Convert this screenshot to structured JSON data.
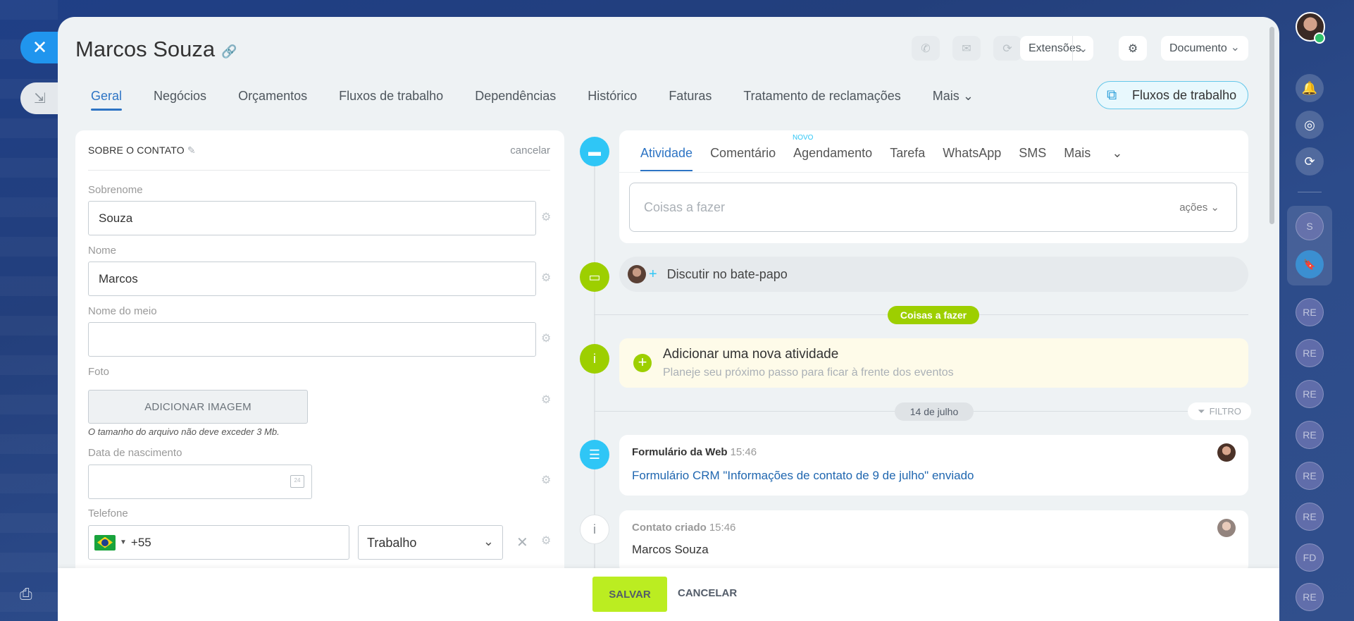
{
  "contact_name": "Marcos Souza",
  "header_buttons": {
    "extensions": "Extensões",
    "document": "Documento"
  },
  "tabs": [
    {
      "label": "Geral"
    },
    {
      "label": "Negócios"
    },
    {
      "label": "Orçamentos"
    },
    {
      "label": "Fluxos de trabalho"
    },
    {
      "label": "Dependências"
    },
    {
      "label": "Histórico"
    },
    {
      "label": "Faturas"
    },
    {
      "label": "Tratamento de reclamações"
    },
    {
      "label": "Mais"
    }
  ],
  "workflows_button": "Fluxos de trabalho",
  "contact_card": {
    "heading": "SOBRE O CONTATO",
    "cancel": "cancelar",
    "surname_label": "Sobrenome",
    "surname_value": "Souza",
    "name_label": "Nome",
    "name_value": "Marcos",
    "middle_label": "Nome do meio",
    "middle_value": "",
    "photo_label": "Foto",
    "add_image": "ADICIONAR IMAGEM",
    "photo_hint": "O tamanho do arquivo não deve exceder 3 Mb.",
    "birth_label": "Data de nascimento",
    "birth_value": "",
    "calendar_day": "24",
    "phone_label": "Telefone",
    "phone_code": "+55",
    "phone_type": "Trabalho"
  },
  "activity": {
    "tabs": [
      "Atividade",
      "Comentário",
      "Agendamento",
      "Tarefa",
      "WhatsApp",
      "SMS",
      "Mais"
    ],
    "new_badge": "NOVO",
    "todo_placeholder": "Coisas a fazer",
    "actions_label": "ações",
    "discuss_chat": "Discutir no bate-papo",
    "todo_pill": "Coisas a fazer",
    "new_activity_title": "Adicionar uma nova atividade",
    "new_activity_sub": "Planeje seu próximo passo para ficar à frente dos eventos",
    "date_pill": "14 de julho",
    "filter_label": "FILTRO"
  },
  "timeline": [
    {
      "title": "Formulário da Web",
      "time": "15:46",
      "text": "Formulário CRM \"Informações de contato de 9 de julho\" enviado"
    },
    {
      "title": "Contato criado",
      "time": "15:46",
      "text": "Marcos Souza"
    }
  ],
  "footer": {
    "save": "SALVAR",
    "cancel": "CANCELAR"
  },
  "right_bar": {
    "group_letter": "S",
    "chats": [
      "RE",
      "RE",
      "RE",
      "RE",
      "RE",
      "RE",
      "FD",
      "RE"
    ]
  },
  "colors": {
    "accent": "#2d74c4",
    "close": "#2095ee",
    "save": "#bbed21",
    "timeline_green": "#9dcf00",
    "timeline_blue": "#2fc6f6"
  }
}
